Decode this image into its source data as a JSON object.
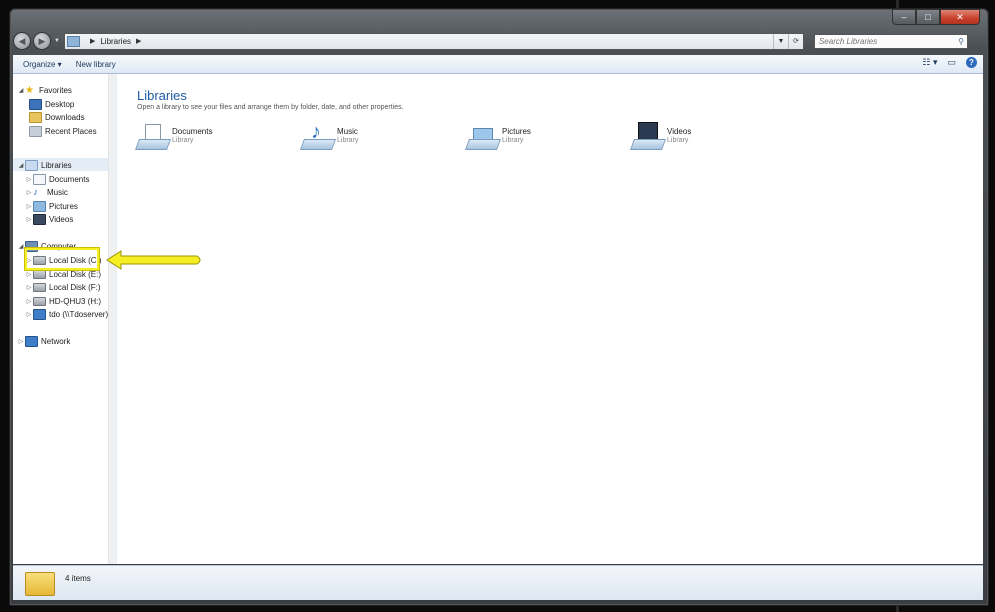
{
  "window": {
    "caption": {
      "minimize": "–",
      "maximize": "□",
      "close": "✕"
    }
  },
  "navbar": {
    "back": "◀",
    "forward": "▶",
    "breadcrumb": [
      "Libraries"
    ],
    "search_placeholder": "Search Libraries"
  },
  "commandbar": {
    "organize": "Organize ▾",
    "new_library": "New library"
  },
  "navpane": {
    "favorites": {
      "label": "Favorites",
      "items": [
        "Desktop",
        "Downloads",
        "Recent Places"
      ]
    },
    "libraries": {
      "label": "Libraries",
      "items": [
        "Documents",
        "Music",
        "Pictures",
        "Videos"
      ]
    },
    "computer": {
      "label": "Computer",
      "items": [
        "Local Disk (C:)",
        "Local Disk (E:)",
        "Local Disk (F:)",
        "HD-QHU3 (H:)",
        "tdo (\\\\Tdoserver) (S:"
      ]
    },
    "network": {
      "label": "Network"
    }
  },
  "main": {
    "title": "Libraries",
    "subtitle": "Open a library to see your files and arrange them by folder, date, and other properties.",
    "libraries": [
      {
        "name": "Documents",
        "type": "Library",
        "icon": "documents-library-icon"
      },
      {
        "name": "Music",
        "type": "Library",
        "icon": "music-library-icon"
      },
      {
        "name": "Pictures",
        "type": "Library",
        "icon": "pictures-library-icon"
      },
      {
        "name": "Videos",
        "type": "Library",
        "icon": "videos-library-icon"
      }
    ]
  },
  "status": {
    "count": "4 items"
  },
  "colors": {
    "accent": "#1e5aa0",
    "highlight": "#f5ee23"
  }
}
